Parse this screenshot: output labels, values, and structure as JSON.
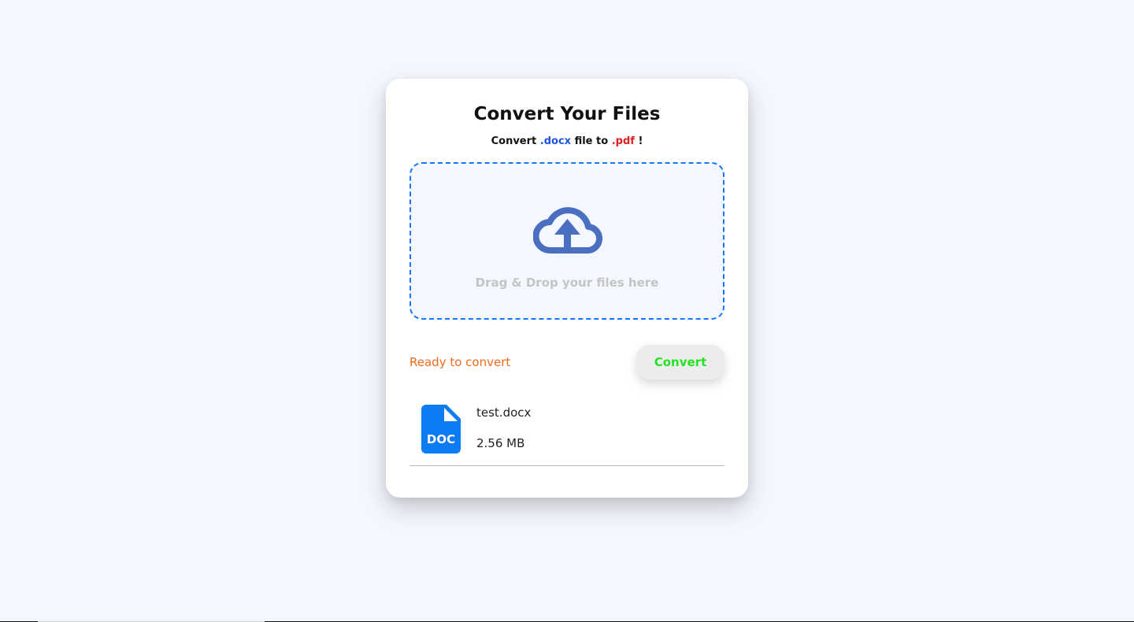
{
  "card": {
    "title": "Convert Your Files",
    "subtitle": {
      "prefix": "Convert ",
      "from_ext": ".docx",
      "middle": " file to ",
      "to_ext": ".pdf",
      "suffix": " !"
    }
  },
  "dropzone": {
    "icon": "cloud-upload-icon",
    "text": "Drag & Drop your files here"
  },
  "status": {
    "text": "Ready to convert",
    "color": "#f26a1b"
  },
  "convert_button": {
    "label": "Convert",
    "color": "#22e322"
  },
  "files": [
    {
      "icon": "doc-file-icon",
      "icon_label": "DOC",
      "name": "test.docx",
      "size": "2.56 MB"
    }
  ],
  "colors": {
    "background": "#f4f7fe",
    "accent_blue": "#1577ff",
    "icon_blue": "#4a6fc1",
    "doc_blue": "#0d7bf2"
  }
}
